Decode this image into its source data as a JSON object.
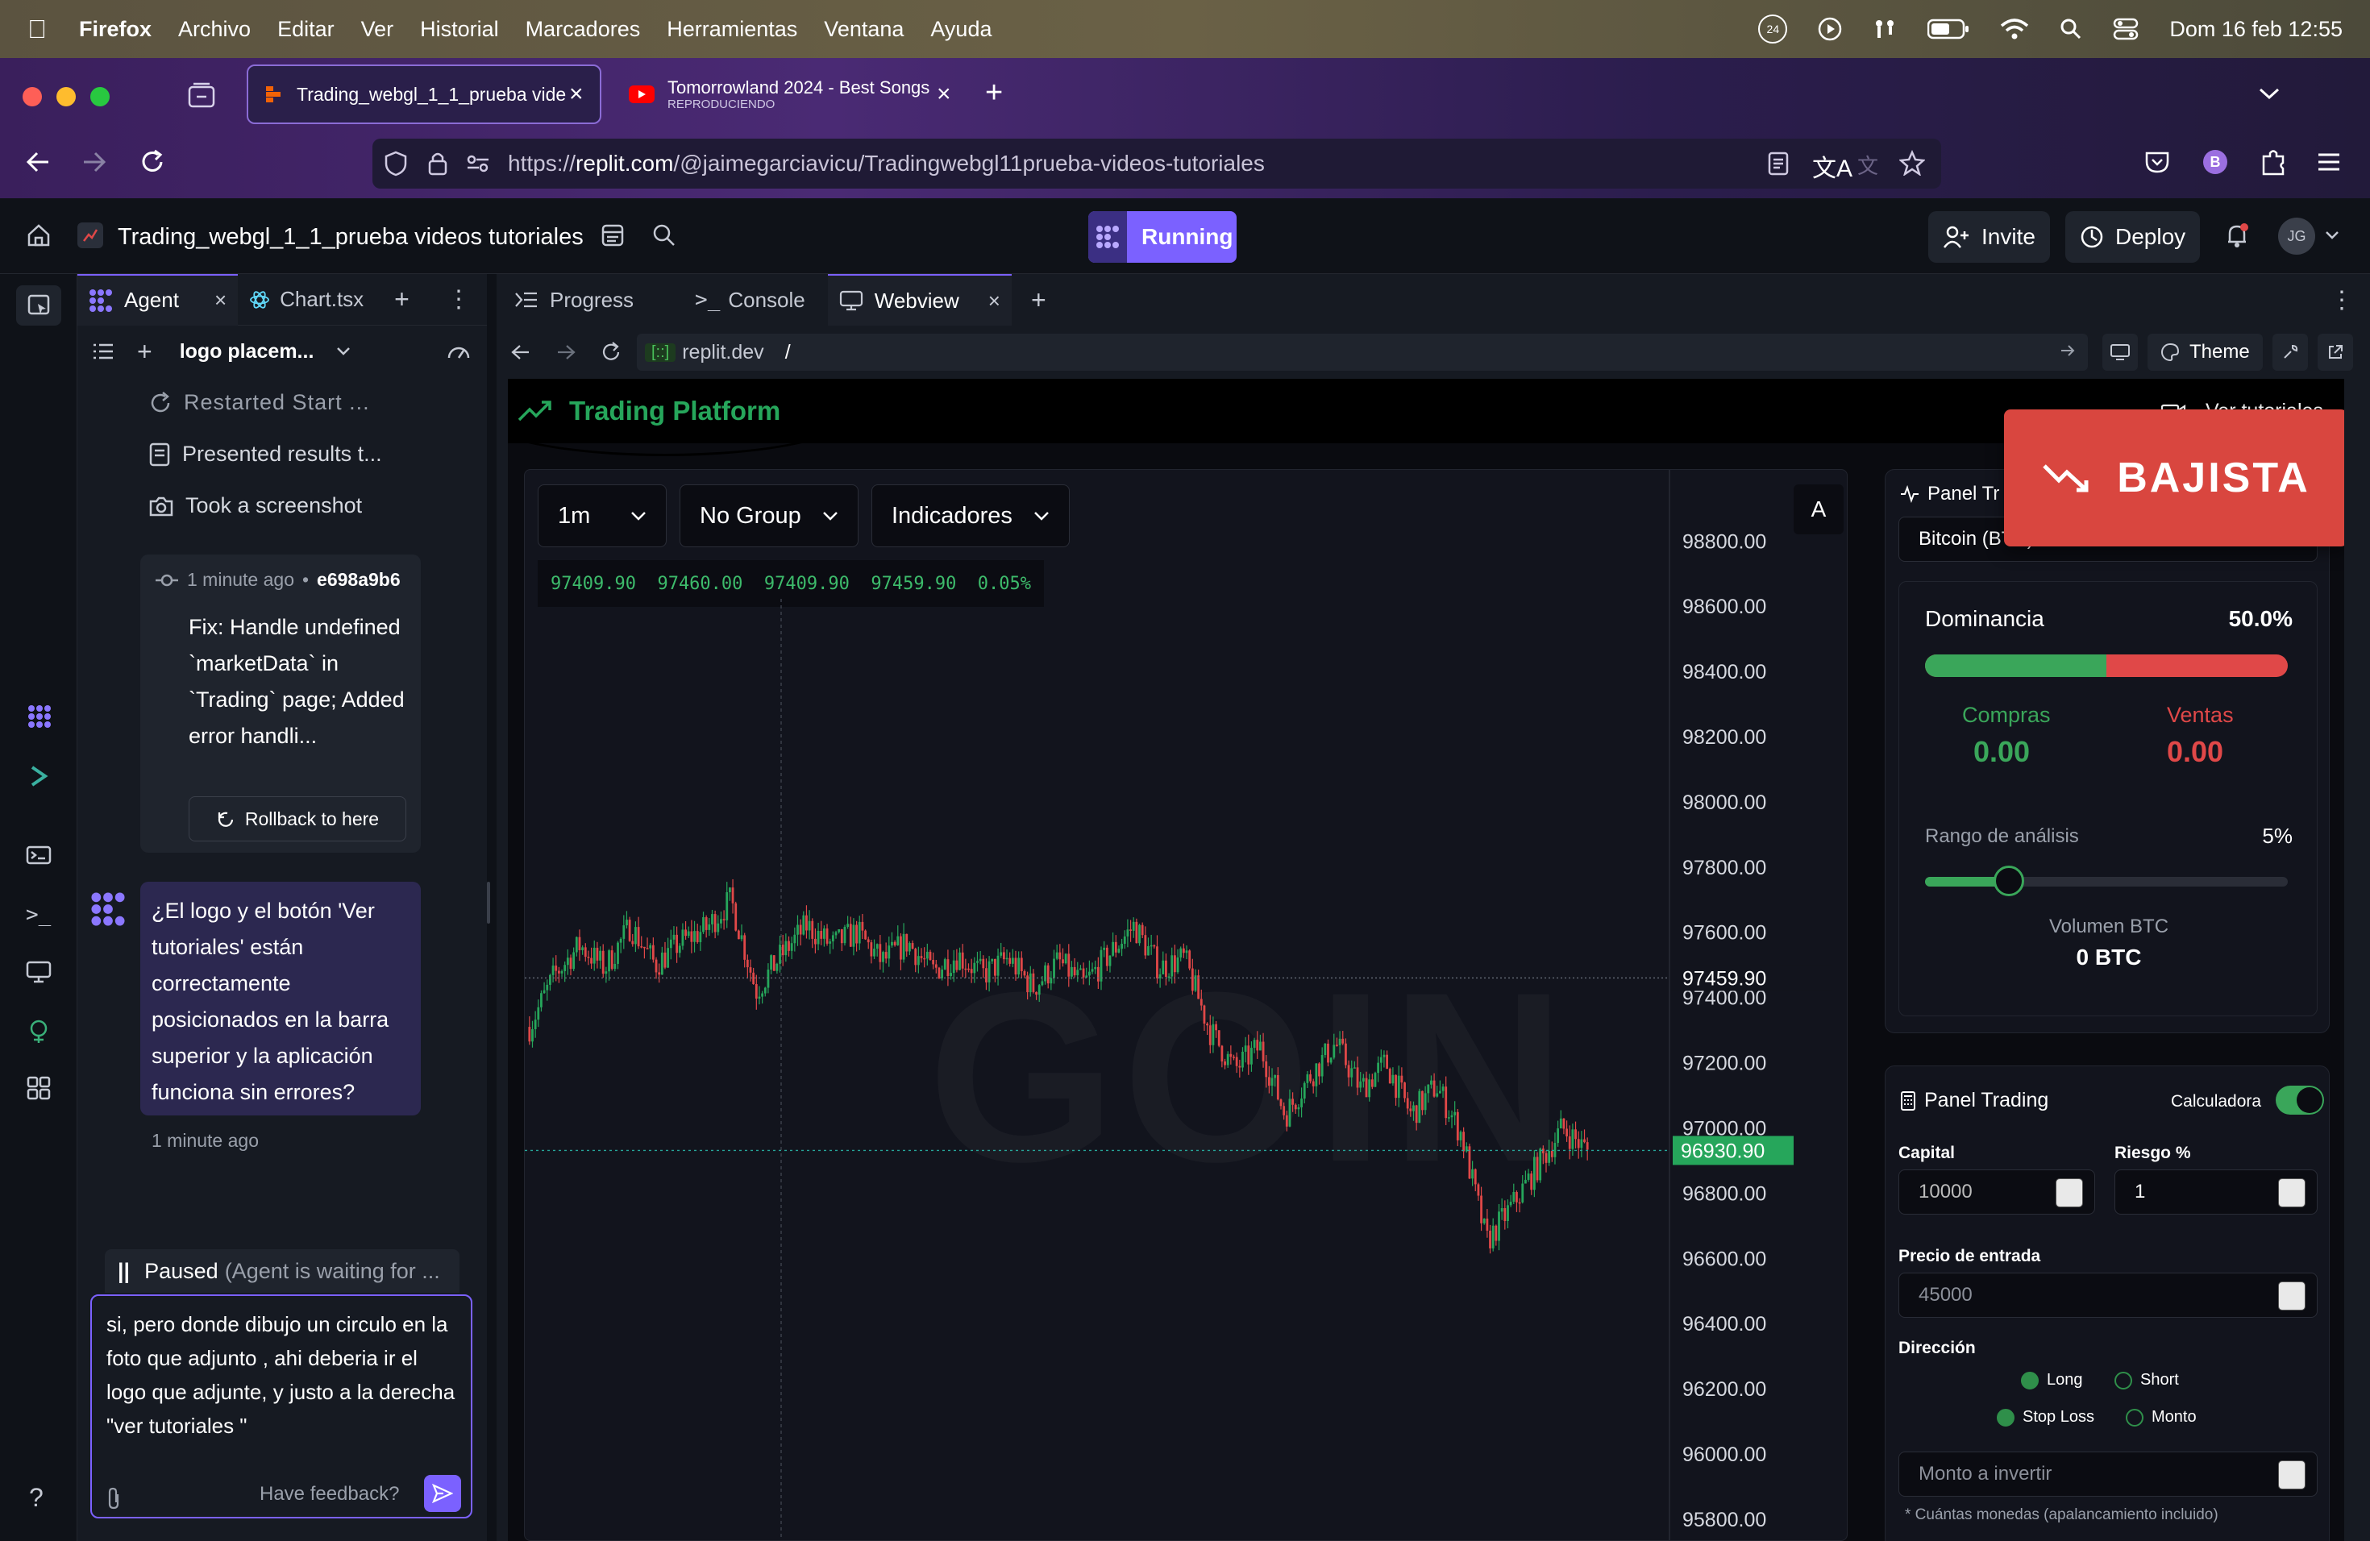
{
  "menubar": {
    "app": "Firefox",
    "items": [
      "Archivo",
      "Editar",
      "Ver",
      "Historial",
      "Marcadores",
      "Herramientas",
      "Ventana",
      "Ayuda"
    ],
    "clock": "Dom 16 feb 12:55",
    "notif_badge": "24"
  },
  "browser": {
    "tabs": [
      {
        "title": "Trading_webgl_1_1_prueba videos tutoriales",
        "active": true
      },
      {
        "title": "Tomorrowland 2024 - Best Songs",
        "subtitle": "REPRODUCIENDO",
        "active": false
      }
    ],
    "url": {
      "prefix": "https://",
      "host": "replit.com",
      "path": "/@jaimegarciavicu/Tradingwebgl11prueba-videos-tutoriales"
    },
    "profile_initial": "B"
  },
  "replit": {
    "project_name": "Trading_webgl_1_1_prueba videos tutoriales",
    "run_status": "Running",
    "invite_label": "Invite",
    "deploy_label": "Deploy",
    "avatar_initials": "JG",
    "agent_tabs": [
      {
        "label": "Agent"
      },
      {
        "label": "Chart.tsx"
      }
    ],
    "agent_toolbar_title": "logo placem...",
    "agent_steps": [
      "Restarted Start ...",
      "Presented results t...",
      "Took a screenshot"
    ],
    "checkpoint": {
      "time": "1 minute ago",
      "hash": "e698a9b6",
      "message": "Fix: Handle undefined `marketData` in `Trading` page; Added error handli...",
      "rollback_label": "Rollback to here"
    },
    "agent_message": {
      "text": "¿El logo y el botón 'Ver tutoriales' están correctamente posicionados en la barra superior y la aplicación funciona sin errores?",
      "time": "1 minute ago"
    },
    "paused_status": {
      "label": "Paused",
      "detail": "(Agent is waiting for ..."
    },
    "chat_input": {
      "value": "si, pero donde dibujo un circulo en la foto que adjunto , ahi deberia ir el logo que adjunte, y justo a la derecha \"ver tutoriales \"",
      "feedback_label": "Have feedback?"
    },
    "main_tabs": [
      {
        "label": "Progress"
      },
      {
        "label": "Console"
      },
      {
        "label": "Webview"
      }
    ],
    "webview_url": {
      "host": "replit.dev",
      "path": "/"
    },
    "theme_label": "Theme"
  },
  "app": {
    "brand": "Trading Platform",
    "tutorials_link": "Ver tutoriales",
    "alert_badge": "BAJISTA",
    "timeframe": "1m",
    "group": "No Group",
    "indicators": "Indicadores",
    "corner_button": "A",
    "ohlc": "97409.90  97460.00  97409.90  97459.90  0.05%",
    "watermark": "GOIN",
    "panel_title_top": "Panel Tr",
    "asset_select": "Bitcoin (BTC)",
    "dominance": {
      "label": "Dominancia",
      "value": "50.0%",
      "buy_fraction": 0.5
    },
    "buys": {
      "label": "Compras",
      "value": "0.00"
    },
    "sells": {
      "label": "Ventas",
      "value": "0.00"
    },
    "range": {
      "label": "Rango de análisis",
      "value": "5%",
      "fraction": 0.23
    },
    "volume": {
      "label": "Volumen BTC",
      "value": "0 BTC"
    },
    "trading_panel": {
      "title": "Panel Trading",
      "calculator_label": "Calculadora",
      "capital_label": "Capital",
      "capital_value": "10000",
      "risk_label": "Riesgo %",
      "risk_value": "1",
      "entry_label": "Precio de entrada",
      "entry_placeholder": "45000",
      "direction_label": "Dirección",
      "options": [
        "Long",
        "Short",
        "Stop Loss",
        "Monto"
      ],
      "amount_placeholder": "Monto a invertir",
      "note": "* Cuántas monedas (apalancamiento incluido)"
    },
    "colors": {
      "up": "#26a65b",
      "down": "#e04848",
      "accent": "#7b61ff"
    }
  },
  "chart_data": {
    "type": "candlestick",
    "y_ticks": [
      "98800.00",
      "98600.00",
      "98400.00",
      "98200.00",
      "98000.00",
      "97800.00",
      "97600.00",
      "97400.00",
      "97200.00",
      "97000.00",
      "96800.00",
      "96600.00",
      "96400.00",
      "96200.00",
      "96000.00",
      "95800.00"
    ],
    "ylim": [
      95780,
      98860
    ],
    "last_price_label": "96930.90",
    "reference_price_label": "97459.90",
    "close_path": [
      97310,
      97470,
      97560,
      97490,
      97620,
      97500,
      97570,
      97610,
      97700,
      97420,
      97530,
      97620,
      97560,
      97600,
      97510,
      97570,
      97480,
      97530,
      97470,
      97520,
      97430,
      97510,
      97440,
      97530,
      97620,
      97490,
      97520,
      97300,
      97180,
      97250,
      97040,
      97160,
      97260,
      97120,
      97200,
      97040,
      97130,
      96980,
      96650,
      96760,
      96880,
      97000,
      96930
    ]
  }
}
